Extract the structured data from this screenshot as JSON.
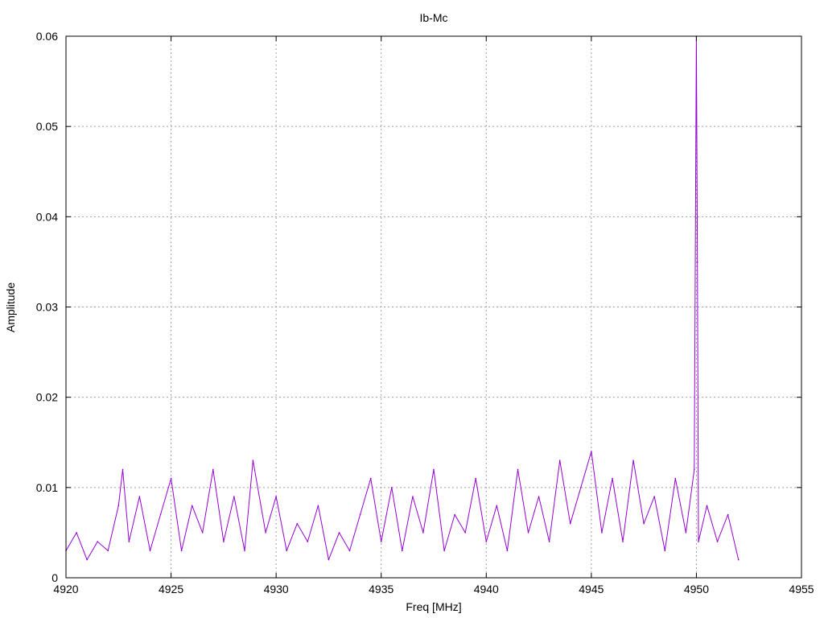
{
  "chart_data": {
    "type": "line",
    "title": "Ib-Mc",
    "xlabel": "Freq [MHz]",
    "ylabel": "Amplitude",
    "xlim": [
      4920,
      4955
    ],
    "ylim": [
      0,
      0.06
    ],
    "x_ticks": [
      "4920",
      "4925",
      "4930",
      "4935",
      "4940",
      "4945",
      "4950",
      "4955"
    ],
    "y_ticks": [
      "0",
      "0.01",
      "0.02",
      "0.03",
      "0.04",
      "0.05",
      "0.06"
    ],
    "grid": true,
    "legend": "none",
    "series": [
      {
        "color": "#9400d3",
        "x": [
          4920.0,
          4920.5,
          4921.0,
          4921.5,
          4922.0,
          4922.5,
          4922.7,
          4923.0,
          4923.5,
          4924.0,
          4924.5,
          4925.0,
          4925.5,
          4926.0,
          4926.5,
          4927.0,
          4927.5,
          4928.0,
          4928.5,
          4928.9,
          4929.5,
          4930.0,
          4930.5,
          4931.0,
          4931.5,
          4932.0,
          4932.5,
          4933.0,
          4933.5,
          4934.0,
          4934.5,
          4935.0,
          4935.5,
          4936.0,
          4936.5,
          4937.0,
          4937.5,
          4938.0,
          4938.5,
          4939.0,
          4939.5,
          4940.0,
          4940.5,
          4941.0,
          4941.5,
          4942.0,
          4942.5,
          4943.0,
          4943.5,
          4944.0,
          4944.5,
          4945.0,
          4945.5,
          4946.0,
          4946.5,
          4947.0,
          4947.5,
          4948.0,
          4948.5,
          4949.0,
          4949.5,
          4949.9,
          4950.0,
          4950.05,
          4950.1,
          4950.5,
          4951.0,
          4951.5,
          4952.0
        ],
        "y": [
          0.003,
          0.005,
          0.002,
          0.004,
          0.003,
          0.008,
          0.012,
          0.004,
          0.009,
          0.003,
          0.007,
          0.011,
          0.003,
          0.008,
          0.005,
          0.012,
          0.004,
          0.009,
          0.003,
          0.013,
          0.005,
          0.009,
          0.003,
          0.006,
          0.004,
          0.008,
          0.002,
          0.005,
          0.003,
          0.007,
          0.011,
          0.004,
          0.01,
          0.003,
          0.009,
          0.005,
          0.012,
          0.003,
          0.007,
          0.005,
          0.011,
          0.004,
          0.008,
          0.003,
          0.012,
          0.005,
          0.009,
          0.004,
          0.013,
          0.006,
          0.01,
          0.014,
          0.005,
          0.011,
          0.004,
          0.013,
          0.006,
          0.009,
          0.003,
          0.011,
          0.005,
          0.012,
          0.06,
          0.035,
          0.004,
          0.008,
          0.004,
          0.007,
          0.002
        ]
      }
    ]
  }
}
